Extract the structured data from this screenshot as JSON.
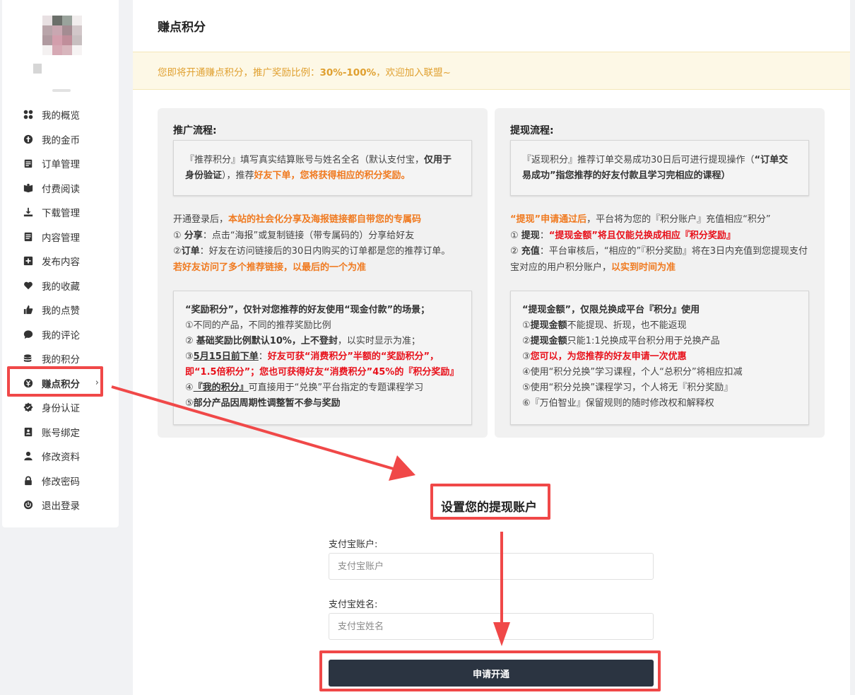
{
  "sidebar": {
    "items": [
      {
        "label": "我的概览",
        "icon": "dashboard-icon"
      },
      {
        "label": "我的金币",
        "icon": "coin-icon"
      },
      {
        "label": "订单管理",
        "icon": "order-icon"
      },
      {
        "label": "付费阅读",
        "icon": "book-icon"
      },
      {
        "label": "下载管理",
        "icon": "download-icon"
      },
      {
        "label": "内容管理",
        "icon": "document-icon"
      },
      {
        "label": "发布内容",
        "icon": "plus-square-icon"
      },
      {
        "label": "我的收藏",
        "icon": "heart-icon"
      },
      {
        "label": "我的点赞",
        "icon": "thumbs-up-icon"
      },
      {
        "label": "我的评论",
        "icon": "comment-icon"
      },
      {
        "label": "我的积分",
        "icon": "database-icon"
      },
      {
        "label": "赚点积分",
        "icon": "yen-icon",
        "active": true
      },
      {
        "label": "身份认证",
        "icon": "verified-icon"
      },
      {
        "label": "账号绑定",
        "icon": "id-card-icon"
      },
      {
        "label": "修改资料",
        "icon": "user-icon"
      },
      {
        "label": "修改密码",
        "icon": "lock-icon"
      },
      {
        "label": "退出登录",
        "icon": "power-icon"
      }
    ],
    "active_chevron": "›"
  },
  "main": {
    "title": "赚点积分",
    "notice": {
      "prefix": "您即将开通赚点积分，推广奖励比例：",
      "ratio": "30%-100%",
      "suffix": "，欢迎加入联盟~"
    },
    "left_panel": {
      "title": "推广流程:",
      "box1": {
        "p1": "『推荐积分』填写真实结算账号与姓名全名（默认支付宝，",
        "p1_bold": "仅用于身份验证",
        "p2": "），推荐",
        "p2_orange": "好友下单，您将获得相应的积分奖励。"
      },
      "text": {
        "l1a": "开通登录后，",
        "l1b": "本站的社会化分享及海报链接都自带您的专属码",
        "l2a": "① ",
        "l2b": "分享",
        "l2c": "：点击“海报”或复制链接（带专属码的）分享给好友",
        "l3a": "②",
        "l3b": "订单",
        "l3c": "：好友在访问链接后的30日内购买的订单都是您的推荐订单。",
        "l4": "若好友访问了多个推荐链接，以最后的一个为准"
      },
      "box2": {
        "l1": "“奖励积分”，仅针对您推荐的好友使用“现金付款”的场景；",
        "l2": "①不同的产品，不同的推荐奖励比例",
        "l3a": "② ",
        "l3b": "基础奖励比例默认10%，上不登封",
        "l3c": "，以实时显示为准；",
        "l4a": "③",
        "l4b": "5月15日前下单",
        "l4c": "：",
        "l4d": "好友可获“消费积分”半额的“奖励积分”，即“1.5倍积分”；您也可获得好友“消费积分”45%的『积分奖励』",
        "l5a": "④",
        "l5b": "『我的积分』",
        "l5c": "可直接用于“兑换”平台指定的专题课程学习",
        "l6a": "⑤",
        "l6b": "部分产品因周期性调整暂不参与奖励"
      }
    },
    "right_panel": {
      "title": "提现流程:",
      "box1": {
        "p1": "『返现积分』推荐订单交易成功30日后可进行提现操作（",
        "p1_bold": "“订单交易成功”指您推荐的好友付款且学习完相应的课程",
        "p2": "）"
      },
      "text": {
        "l1a": "“提现”申请通过后",
        "l1b": "，平台将为您的『积分账户』充值相应“积分”",
        "l2a": "① ",
        "l2b": "提现",
        "l2c": "：",
        "l2d": "“提现金额”将且仅能兑换成相应『积分奖励』",
        "l3a": "② ",
        "l3b": "充值",
        "l3c": "：平台审核后，“相应的”『积分奖励』将在3日内充值到您提现支付宝对应的用户积分账户，",
        "l3d": "以实到时间为准"
      },
      "box2": {
        "l1": "“提现金额”，仅限兑换成平台『积分』使用",
        "l2a": "①",
        "l2b": "提现金额",
        "l2c": "不能提现、折现，也不能返现",
        "l3a": "②",
        "l3b": "提现金额",
        "l3c": "只能1:1兑换成平台积分用于兑换产品",
        "l4a": "③",
        "l4b": "您可以，为您推荐的好友申请一次优惠",
        "l5": "④使用“积分兑换”学习课程，个人“总积分”将相应扣减",
        "l6": "⑤使用“积分兑换”课程学习，个人将无『积分奖励』",
        "l7": "⑥『万伯智业』保留规则的随时修改权和解释权"
      }
    },
    "form": {
      "title": "设置您的提现账户",
      "alipay_account_label": "支付宝账户:",
      "alipay_account_placeholder": "支付宝账户",
      "alipay_name_label": "支付宝姓名:",
      "alipay_name_placeholder": "支付宝姓名",
      "submit_label": "申请开通"
    }
  },
  "colors": {
    "accent_dark": "#2b3441",
    "highlight_red": "#f04848",
    "orange": "#f07a20",
    "red_text": "#e8101a",
    "notice_text": "#e0a030",
    "notice_bg": "#fdf8e6"
  }
}
